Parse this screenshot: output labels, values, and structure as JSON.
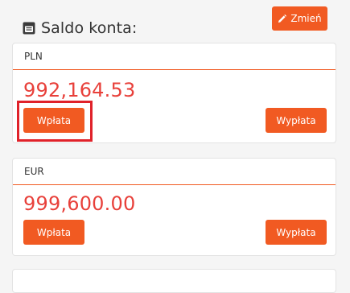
{
  "header": {
    "title": "Saldo konta:",
    "edit_label": "Zmień",
    "icon": "wallet-icon",
    "edit_icon": "pencil-icon"
  },
  "accounts": [
    {
      "currency": "PLN",
      "balance": "992,164.53",
      "deposit_label": "Wpłata",
      "withdraw_label": "Wypłata"
    },
    {
      "currency": "EUR",
      "balance": "999,600.00",
      "deposit_label": "Wpłata",
      "withdraw_label": "Wypłata"
    }
  ],
  "colors": {
    "accent": "#f15a22",
    "amount": "#e8403a",
    "highlight": "#e0222a"
  }
}
